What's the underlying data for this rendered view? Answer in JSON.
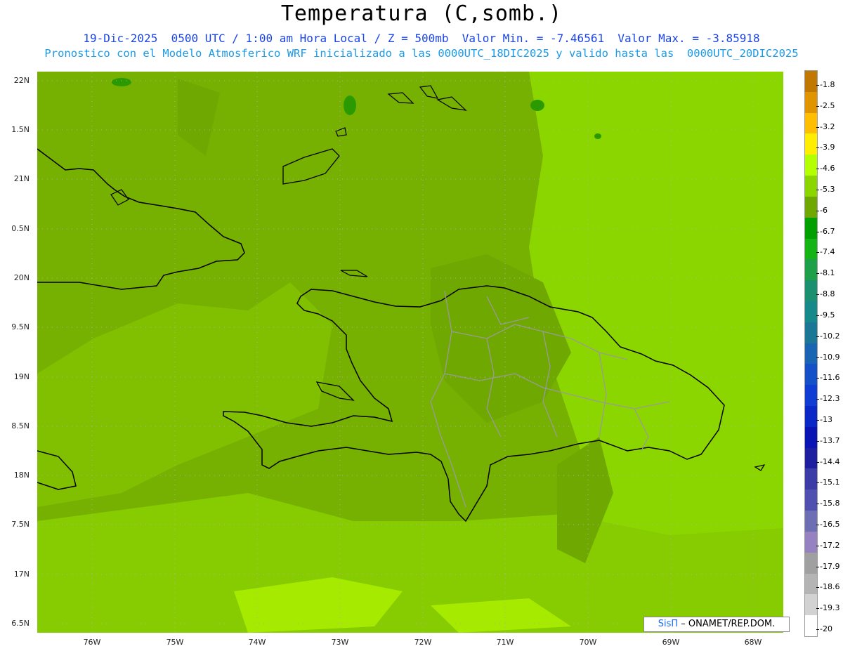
{
  "header": {
    "title": "Temperatura (C,somb.)",
    "subtitle_1": "19-Dic-2025  0500 UTC / 1:00 am Hora Local / Z = 500mb  Valor Min. = -7.46561  Valor Max. = -3.85918",
    "subtitle_2": "Pronostico con el Modelo Atmosferico WRF inicializado a las 0000UTC_18DIC2025 y valido hasta las  0000UTC_20DIC2025"
  },
  "axes": {
    "lat_labels": [
      "22N",
      "1.5N",
      "21N",
      "0.5N",
      "20N",
      "9.5N",
      "19N",
      "8.5N",
      "18N",
      "7.5N",
      "17N",
      "6.5N"
    ],
    "lon_labels": [
      "76W",
      "75W",
      "74W",
      "73W",
      "72W",
      "71W",
      "70W",
      "69W",
      "68W"
    ]
  },
  "colorbar": {
    "labels": [
      "-1.8",
      "-2.5",
      "-3.2",
      "-3.9",
      "-4.6",
      "-5.3",
      "-6",
      "-6.7",
      "-7.4",
      "-8.1",
      "-8.8",
      "-9.5",
      "-10.2",
      "-10.9",
      "-11.6",
      "-12.3",
      "-13",
      "-13.7",
      "-14.4",
      "-15.1",
      "-15.8",
      "-16.5",
      "-17.2",
      "-17.9",
      "-18.6",
      "-19.3",
      "-20"
    ],
    "colors": [
      "#c07800",
      "#e09400",
      "#ffbe00",
      "#ffee00",
      "#b4ff00",
      "#8cd600",
      "#6ea800",
      "#00a000",
      "#14b414",
      "#1ea048",
      "#1a9070",
      "#168a8a",
      "#1a7896",
      "#1a64b4",
      "#1450c8",
      "#0f3cd2",
      "#0a28c8",
      "#0a14b4",
      "#1e1ea0",
      "#3c3ca8",
      "#5050b0",
      "#6e6eb4",
      "#9682c0",
      "#a0a0a0",
      "#b4b4b4",
      "#d2d2d2",
      "#ffffff"
    ]
  },
  "credit": {
    "brand": "SisΠ",
    "text": "– ONAMET/REP.DOM."
  }
}
